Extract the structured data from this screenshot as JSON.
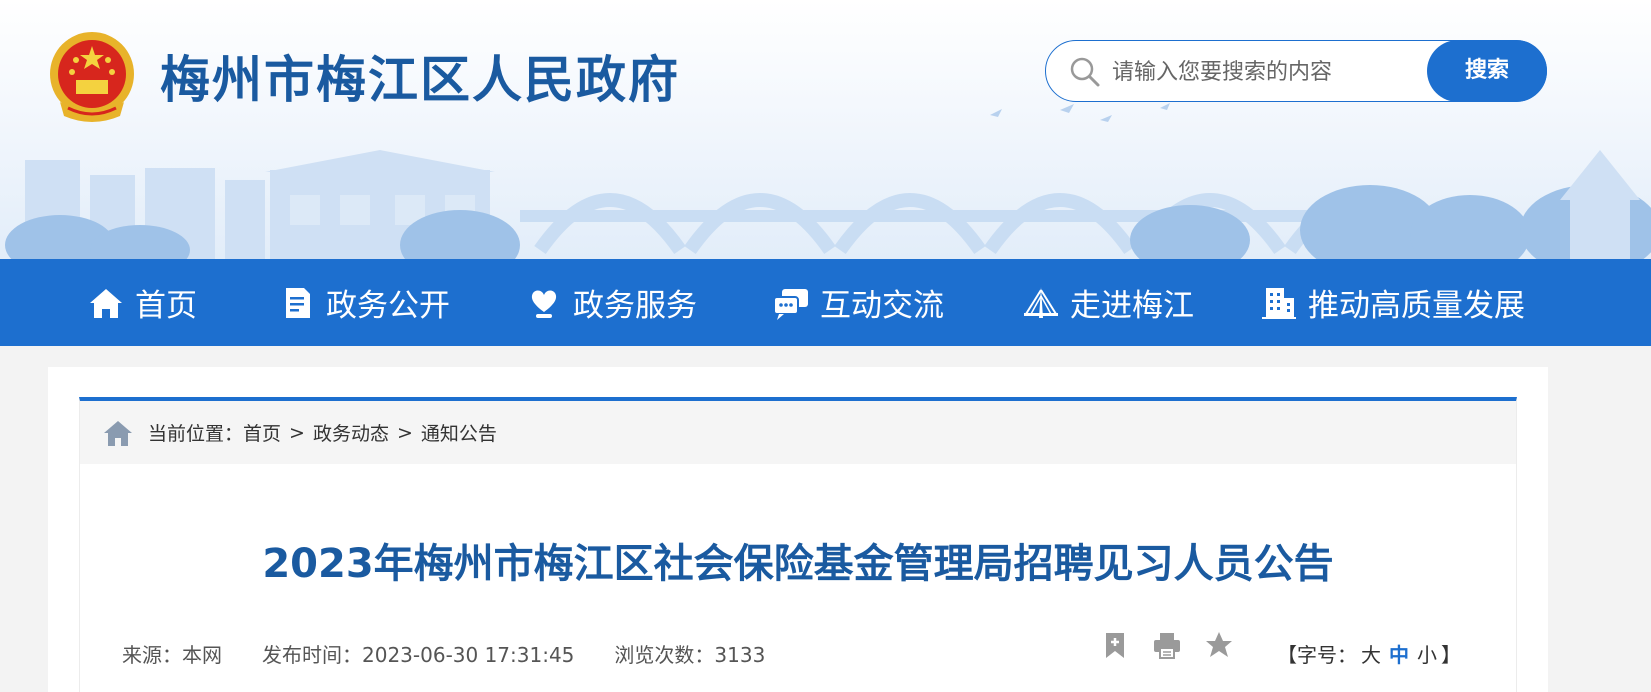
{
  "header": {
    "site_title": "梅州市梅江区人民政府",
    "emblem_icon": "national-emblem-icon",
    "search": {
      "placeholder": "请输入您要搜索的内容",
      "value": "",
      "button_label": "搜索"
    }
  },
  "nav": {
    "items": [
      {
        "label": "首页",
        "icon": "home-icon"
      },
      {
        "label": "政务公开",
        "icon": "document-icon"
      },
      {
        "label": "政务服务",
        "icon": "heart-hand-icon"
      },
      {
        "label": "互动交流",
        "icon": "chat-icon"
      },
      {
        "label": "走进梅江",
        "icon": "bridge-icon"
      },
      {
        "label": "推动高质量发展",
        "icon": "building-icon"
      }
    ]
  },
  "breadcrumb": {
    "prefix": "当前位置：",
    "items": [
      "首页",
      "政务动态",
      "通知公告"
    ],
    "separator": ">"
  },
  "article": {
    "title": "2023年梅州市梅江区社会保险基金管理局招聘见习人员公告",
    "source_label": "来源：本网",
    "publish_label": "发布时间：2023-06-30 17:31:45",
    "views_label": "浏览次数：3133",
    "fontsize": {
      "prefix": "【字号：",
      "large": "大",
      "medium": "中",
      "small": "小",
      "suffix": "】",
      "active": "medium"
    }
  },
  "colors": {
    "brand_blue": "#1d6fcf",
    "title_blue": "#1a5aa0"
  }
}
